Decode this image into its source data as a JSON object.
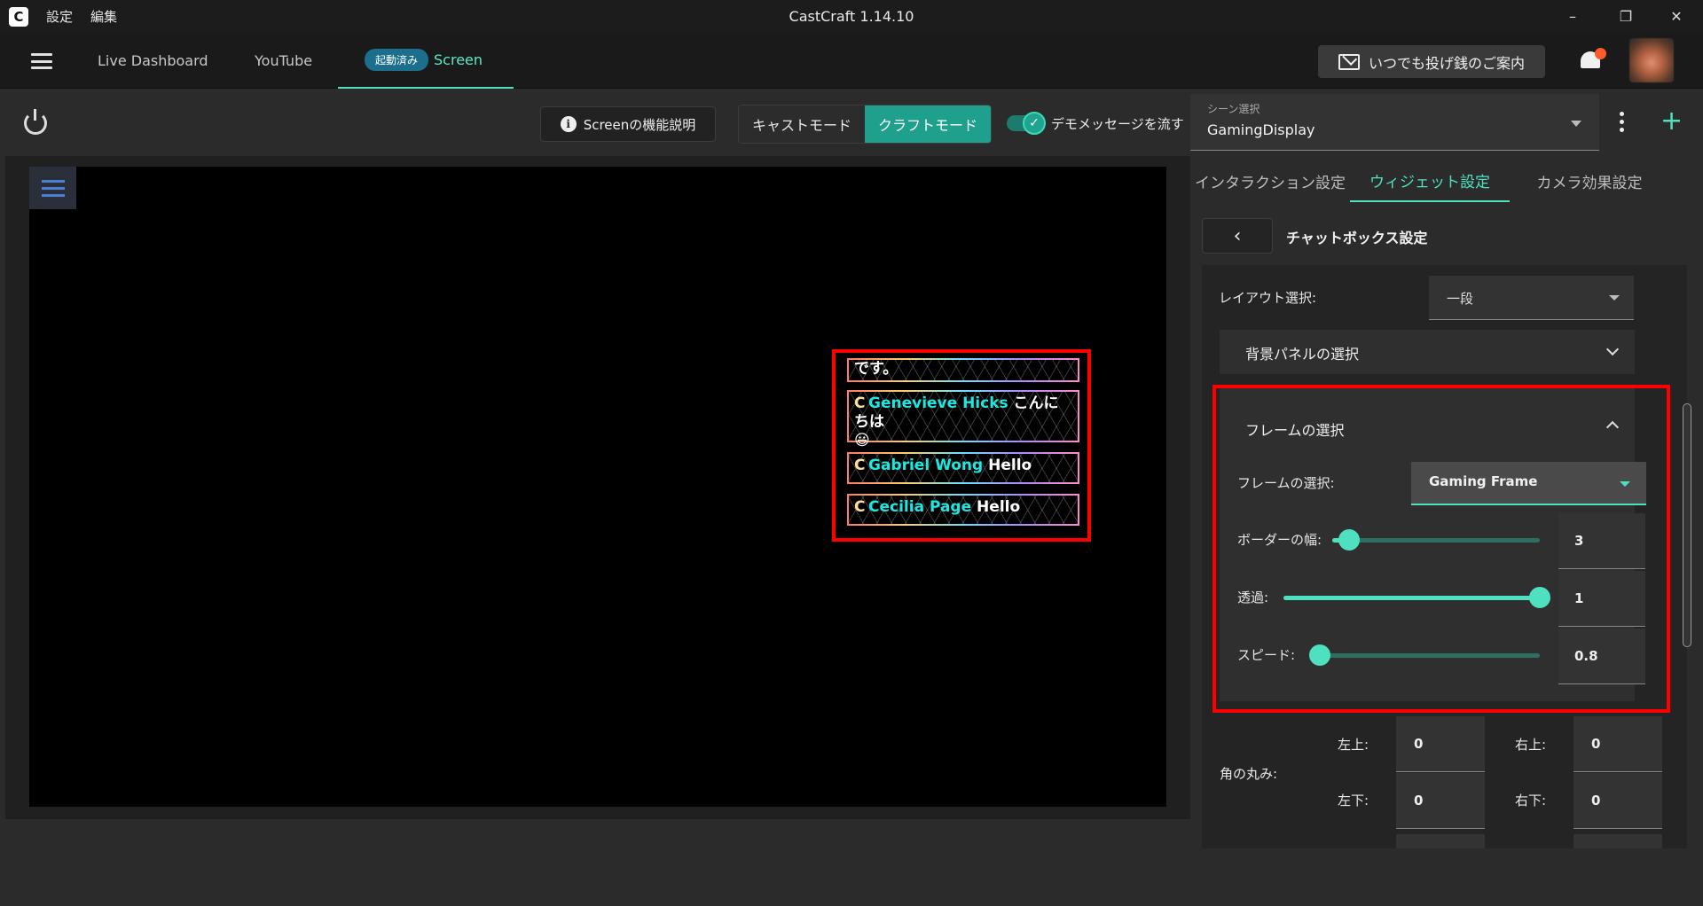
{
  "titlebar": {
    "logo": "C",
    "menu": [
      "設定",
      "編集"
    ],
    "title": "CastCraft 1.14.10",
    "controls": {
      "minimize": "–",
      "maximize": "❐",
      "close": "✕"
    }
  },
  "nav": {
    "tabs": [
      {
        "label": "Live Dashboard"
      },
      {
        "label": "YouTube"
      },
      {
        "label": "Screen",
        "badge": "起動済み"
      }
    ],
    "tip_button": "いつでも投げ銭のご案内"
  },
  "toolbar": {
    "info_button": "Screenの機能説明",
    "info_icon": "i",
    "modes": [
      "キャストモード",
      "クラフトモード"
    ],
    "active_mode": "クラフトモード",
    "demo_toggle_label": "デモメッセージを流す",
    "demo_toggle_on": true,
    "toggle_check": "✓"
  },
  "scene": {
    "caption": "シーン選択",
    "value": "GamingDisplay"
  },
  "preview": {
    "messages": [
      {
        "icon": "",
        "name": "",
        "text": "です。"
      },
      {
        "icon": "C",
        "name": "Genevieve Hicks",
        "text": " こんにちは",
        "line2": "😃"
      },
      {
        "icon": "C",
        "name": "Gabriel Wong",
        "text": " Hello"
      },
      {
        "icon": "C",
        "name": "Cecilia Page",
        "text": " Hello"
      }
    ]
  },
  "panel": {
    "tabs": [
      "インタラクション設定",
      "ウィジェット設定",
      "カメラ効果設定"
    ],
    "active_tab": "ウィジェット設定",
    "back_label": "‹",
    "section_title": "チャットボックス設定",
    "layout_label": "レイアウト選択:",
    "layout_value": "一段",
    "background_panel_label": "背景パネルの選択",
    "frame_section_label": "フレームの選択",
    "frame_select_label": "フレームの選択:",
    "frame_select_value": "Gaming Frame",
    "border_width": {
      "label": "ボーダーの幅:",
      "value": "3",
      "fraction": 0.08
    },
    "opacity": {
      "label": "透過:",
      "value": "1",
      "fraction": 1.0
    },
    "speed": {
      "label": "スピード:",
      "value": "0.8",
      "fraction": 0.0
    },
    "corner_label": "角の丸み:",
    "corners": {
      "top_left": {
        "label": "左上:",
        "value": "0"
      },
      "top_right": {
        "label": "右上:",
        "value": "0"
      },
      "bottom_left": {
        "label": "左下:",
        "value": "0"
      },
      "bottom_right": {
        "label": "右下:",
        "value": "0"
      }
    }
  },
  "colors": {
    "accent": "#4fe0c0",
    "highlight": "#ff0000",
    "active_mode": "#1fa08c",
    "running_badge": "#1c6f8c"
  }
}
